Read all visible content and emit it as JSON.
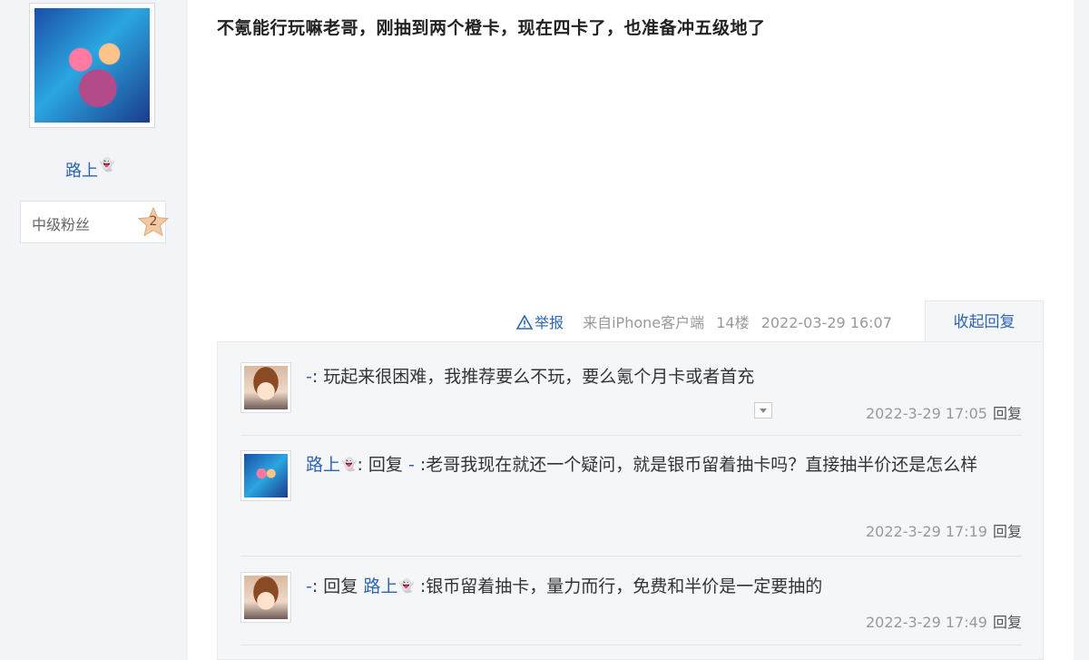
{
  "author": {
    "name": "路上",
    "ghost_icon": "👻",
    "level_name": "中级粉丝",
    "level_number": "2"
  },
  "post": {
    "content": "不氪能行玩嘛老哥，刚抽到两个橙卡，现在四卡了，也准备冲五级地了",
    "report_label": "举报",
    "source": "来自iPhone客户端",
    "floor": "14楼",
    "time": "2022-03-29 16:07",
    "collapse_label": "收起回复"
  },
  "replies": [
    {
      "user": "-",
      "text": ": 玩起来很困难，我推荐要么不玩，要么氪个月卡或者首充",
      "time": "2022-3-29 17:05",
      "reply_label": "回复"
    },
    {
      "user": "路上",
      "reply_to_prefix": ": 回复 ",
      "reply_to": "-",
      "text": " :老哥我现在就还一个疑问，就是银币留着抽卡吗？直接抽半价还是怎么样",
      "time": "2022-3-29 17:19",
      "reply_label": "回复"
    },
    {
      "user": "-",
      "reply_to_prefix": ": 回复 ",
      "reply_to": "路上",
      "text": " :银币留着抽卡，量力而行，免费和半价是一定要抽的",
      "time": "2022-3-29 17:49",
      "reply_label": "回复"
    }
  ]
}
